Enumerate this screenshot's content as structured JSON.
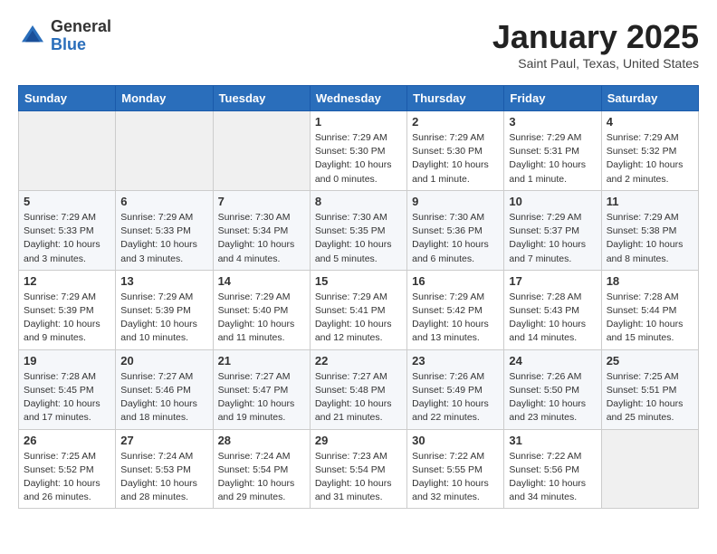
{
  "logo": {
    "general": "General",
    "blue": "Blue"
  },
  "title": "January 2025",
  "location": "Saint Paul, Texas, United States",
  "days_header": [
    "Sunday",
    "Monday",
    "Tuesday",
    "Wednesday",
    "Thursday",
    "Friday",
    "Saturday"
  ],
  "weeks": [
    [
      {
        "day": "",
        "info": ""
      },
      {
        "day": "",
        "info": ""
      },
      {
        "day": "",
        "info": ""
      },
      {
        "day": "1",
        "info": "Sunrise: 7:29 AM\nSunset: 5:30 PM\nDaylight: 10 hours\nand 0 minutes."
      },
      {
        "day": "2",
        "info": "Sunrise: 7:29 AM\nSunset: 5:30 PM\nDaylight: 10 hours\nand 1 minute."
      },
      {
        "day": "3",
        "info": "Sunrise: 7:29 AM\nSunset: 5:31 PM\nDaylight: 10 hours\nand 1 minute."
      },
      {
        "day": "4",
        "info": "Sunrise: 7:29 AM\nSunset: 5:32 PM\nDaylight: 10 hours\nand 2 minutes."
      }
    ],
    [
      {
        "day": "5",
        "info": "Sunrise: 7:29 AM\nSunset: 5:33 PM\nDaylight: 10 hours\nand 3 minutes."
      },
      {
        "day": "6",
        "info": "Sunrise: 7:29 AM\nSunset: 5:33 PM\nDaylight: 10 hours\nand 3 minutes."
      },
      {
        "day": "7",
        "info": "Sunrise: 7:30 AM\nSunset: 5:34 PM\nDaylight: 10 hours\nand 4 minutes."
      },
      {
        "day": "8",
        "info": "Sunrise: 7:30 AM\nSunset: 5:35 PM\nDaylight: 10 hours\nand 5 minutes."
      },
      {
        "day": "9",
        "info": "Sunrise: 7:30 AM\nSunset: 5:36 PM\nDaylight: 10 hours\nand 6 minutes."
      },
      {
        "day": "10",
        "info": "Sunrise: 7:29 AM\nSunset: 5:37 PM\nDaylight: 10 hours\nand 7 minutes."
      },
      {
        "day": "11",
        "info": "Sunrise: 7:29 AM\nSunset: 5:38 PM\nDaylight: 10 hours\nand 8 minutes."
      }
    ],
    [
      {
        "day": "12",
        "info": "Sunrise: 7:29 AM\nSunset: 5:39 PM\nDaylight: 10 hours\nand 9 minutes."
      },
      {
        "day": "13",
        "info": "Sunrise: 7:29 AM\nSunset: 5:39 PM\nDaylight: 10 hours\nand 10 minutes."
      },
      {
        "day": "14",
        "info": "Sunrise: 7:29 AM\nSunset: 5:40 PM\nDaylight: 10 hours\nand 11 minutes."
      },
      {
        "day": "15",
        "info": "Sunrise: 7:29 AM\nSunset: 5:41 PM\nDaylight: 10 hours\nand 12 minutes."
      },
      {
        "day": "16",
        "info": "Sunrise: 7:29 AM\nSunset: 5:42 PM\nDaylight: 10 hours\nand 13 minutes."
      },
      {
        "day": "17",
        "info": "Sunrise: 7:28 AM\nSunset: 5:43 PM\nDaylight: 10 hours\nand 14 minutes."
      },
      {
        "day": "18",
        "info": "Sunrise: 7:28 AM\nSunset: 5:44 PM\nDaylight: 10 hours\nand 15 minutes."
      }
    ],
    [
      {
        "day": "19",
        "info": "Sunrise: 7:28 AM\nSunset: 5:45 PM\nDaylight: 10 hours\nand 17 minutes."
      },
      {
        "day": "20",
        "info": "Sunrise: 7:27 AM\nSunset: 5:46 PM\nDaylight: 10 hours\nand 18 minutes."
      },
      {
        "day": "21",
        "info": "Sunrise: 7:27 AM\nSunset: 5:47 PM\nDaylight: 10 hours\nand 19 minutes."
      },
      {
        "day": "22",
        "info": "Sunrise: 7:27 AM\nSunset: 5:48 PM\nDaylight: 10 hours\nand 21 minutes."
      },
      {
        "day": "23",
        "info": "Sunrise: 7:26 AM\nSunset: 5:49 PM\nDaylight: 10 hours\nand 22 minutes."
      },
      {
        "day": "24",
        "info": "Sunrise: 7:26 AM\nSunset: 5:50 PM\nDaylight: 10 hours\nand 23 minutes."
      },
      {
        "day": "25",
        "info": "Sunrise: 7:25 AM\nSunset: 5:51 PM\nDaylight: 10 hours\nand 25 minutes."
      }
    ],
    [
      {
        "day": "26",
        "info": "Sunrise: 7:25 AM\nSunset: 5:52 PM\nDaylight: 10 hours\nand 26 minutes."
      },
      {
        "day": "27",
        "info": "Sunrise: 7:24 AM\nSunset: 5:53 PM\nDaylight: 10 hours\nand 28 minutes."
      },
      {
        "day": "28",
        "info": "Sunrise: 7:24 AM\nSunset: 5:54 PM\nDaylight: 10 hours\nand 29 minutes."
      },
      {
        "day": "29",
        "info": "Sunrise: 7:23 AM\nSunset: 5:54 PM\nDaylight: 10 hours\nand 31 minutes."
      },
      {
        "day": "30",
        "info": "Sunrise: 7:22 AM\nSunset: 5:55 PM\nDaylight: 10 hours\nand 32 minutes."
      },
      {
        "day": "31",
        "info": "Sunrise: 7:22 AM\nSunset: 5:56 PM\nDaylight: 10 hours\nand 34 minutes."
      },
      {
        "day": "",
        "info": ""
      }
    ]
  ]
}
